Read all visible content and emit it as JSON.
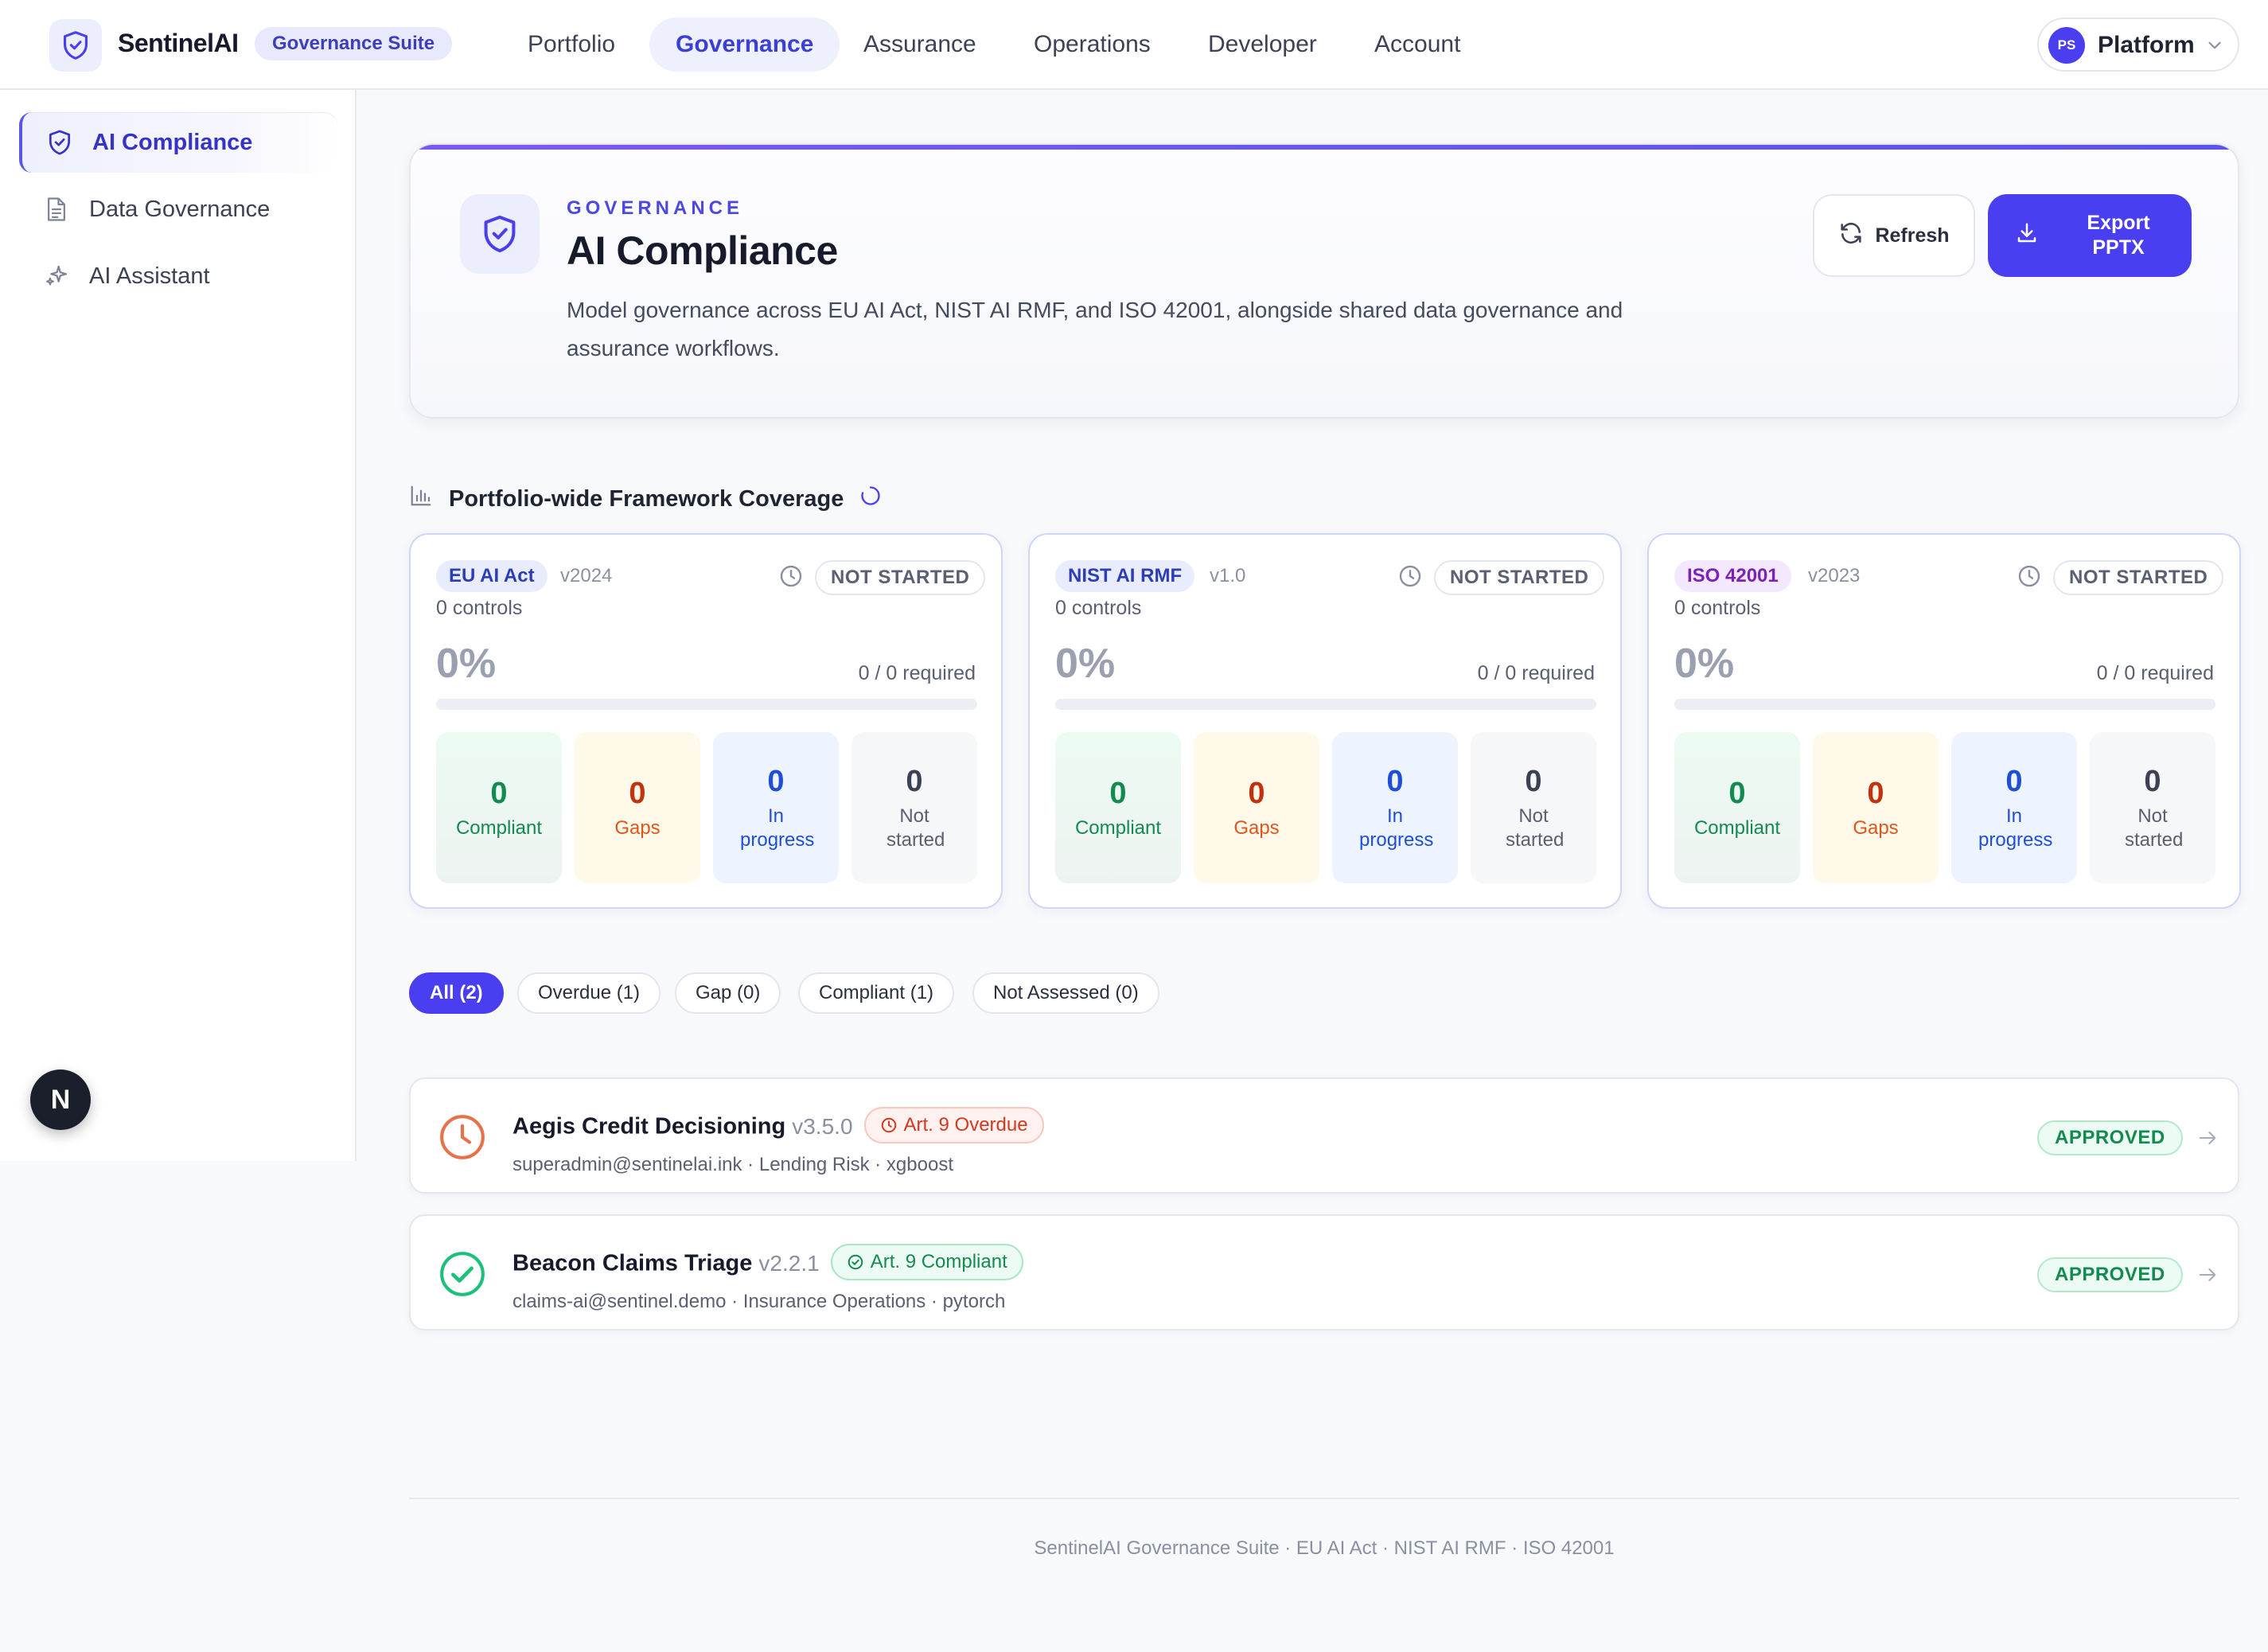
{
  "brand": {
    "name": "SentinelAI",
    "badge": "Governance Suite"
  },
  "nav": [
    {
      "label": "Portfolio",
      "active": false
    },
    {
      "label": "Governance",
      "active": true
    },
    {
      "label": "Assurance",
      "active": false
    },
    {
      "label": "Operations",
      "active": false
    },
    {
      "label": "Developer",
      "active": false
    },
    {
      "label": "Account",
      "active": false
    }
  ],
  "user": {
    "initials": "PS",
    "name": "Platform"
  },
  "sidebar": {
    "items": [
      {
        "label": "AI Compliance",
        "icon": "shield-check-icon",
        "active": true
      },
      {
        "label": "Data Governance",
        "icon": "document-icon",
        "active": false
      },
      {
        "label": "AI Assistant",
        "icon": "sparkles-icon",
        "active": false
      }
    ],
    "fab_label": "N"
  },
  "header": {
    "eyebrow": "GOVERNANCE",
    "title": "AI Compliance",
    "description": "Model governance across EU AI Act, NIST AI RMF, and ISO 42001, alongside shared data governance and assurance workflows.",
    "refresh_label": "Refresh",
    "export_label": "Export PPTX"
  },
  "coverage": {
    "title": "Portfolio-wide Framework Coverage",
    "frameworks": [
      {
        "name": "EU AI Act",
        "version": "v2024",
        "controls": "0 controls",
        "status": "NOT STARTED",
        "percent": "0%",
        "required": "0 / 0 required",
        "progress": 0,
        "stats": {
          "compliant": "0",
          "gaps": "0",
          "in_progress": "0",
          "not_started": "0"
        },
        "tag_bg": "#e8ecfd",
        "tag_color": "#2b3db8"
      },
      {
        "name": "NIST AI RMF",
        "version": "v1.0",
        "controls": "0 controls",
        "status": "NOT STARTED",
        "percent": "0%",
        "required": "0 / 0 required",
        "progress": 0,
        "stats": {
          "compliant": "0",
          "gaps": "0",
          "in_progress": "0",
          "not_started": "0"
        },
        "tag_bg": "#e8ecfd",
        "tag_color": "#2b3db8"
      },
      {
        "name": "ISO 42001",
        "version": "v2023",
        "controls": "0 controls",
        "status": "NOT STARTED",
        "percent": "0%",
        "required": "0 / 0 required",
        "progress": 0,
        "stats": {
          "compliant": "0",
          "gaps": "0",
          "in_progress": "0",
          "not_started": "0"
        },
        "tag_bg": "#f3e8fd",
        "tag_color": "#7a22b8"
      }
    ],
    "stat_labels": {
      "compliant": "Compliant",
      "gaps": "Gaps",
      "in_progress": "In progress",
      "not_started": "Not started"
    }
  },
  "filters": [
    {
      "label": "All (2)",
      "active": true
    },
    {
      "label": "Overdue (1)",
      "active": false
    },
    {
      "label": "Gap (0)",
      "active": false
    },
    {
      "label": "Compliant (1)",
      "active": false
    },
    {
      "label": "Not Assessed (0)",
      "active": false
    }
  ],
  "models": [
    {
      "name": "Aegis Credit Decisioning",
      "version": "v3.5.0",
      "article": "Art. 9 Overdue",
      "article_state": "overdue",
      "meta": "superadmin@sentinelai.ink · Lending Risk · xgboost",
      "status": "APPROVED",
      "icon": "clock-icon"
    },
    {
      "name": "Beacon Claims Triage",
      "version": "v2.2.1",
      "article": "Art. 9 Compliant",
      "article_state": "compliant",
      "meta": "claims-ai@sentinel.demo · Insurance Operations · pytorch",
      "status": "APPROVED",
      "icon": "check-circle-icon"
    }
  ],
  "footer": {
    "text": "SentinelAI Governance Suite · EU AI Act · NIST AI RMF · ISO 42001"
  },
  "colors": {
    "accent": "#4a3ff0",
    "compliant": "#138a4f",
    "gap": "#c3320f",
    "in_progress": "#1f4fd6",
    "overdue": "#d23a1e"
  }
}
